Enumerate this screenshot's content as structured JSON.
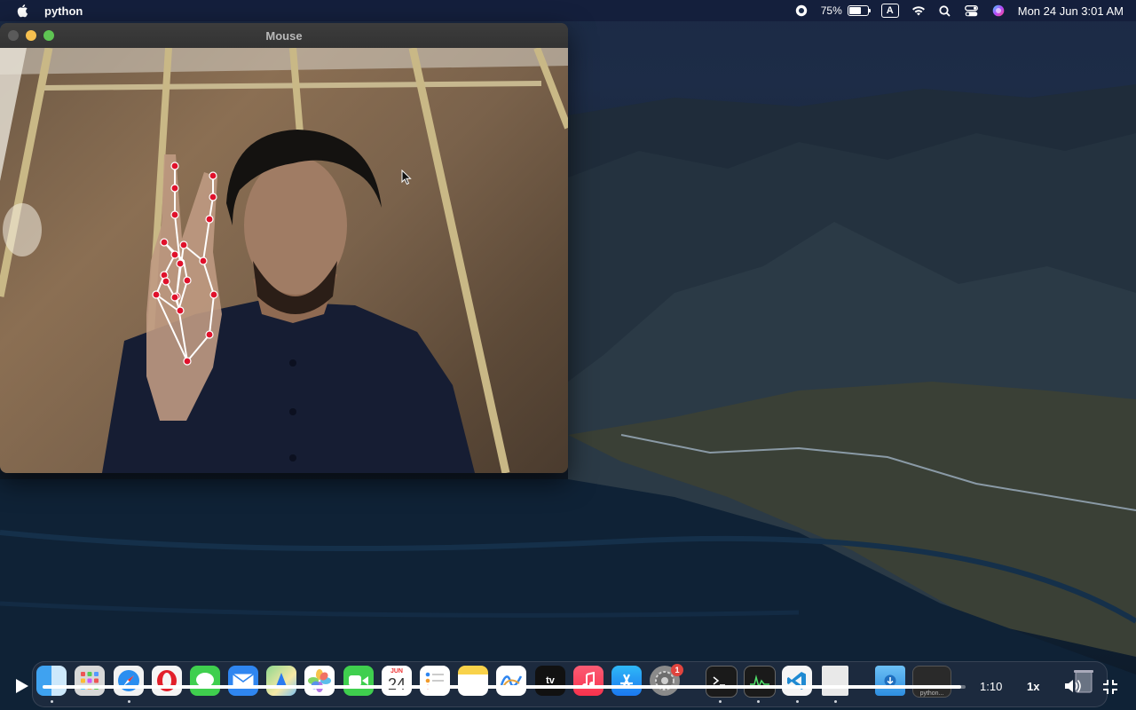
{
  "menubar": {
    "app_name": "python",
    "battery_percent": "75%",
    "battery_level": 0.75,
    "input_source": "A",
    "datetime": "Mon 24 Jun  3:01 AM"
  },
  "window": {
    "title": "Mouse"
  },
  "player": {
    "time": "1:10",
    "speed": "1x",
    "progress": 0.995
  },
  "dock": {
    "calendar_month": "JUN",
    "calendar_day": "24",
    "settings_badge": "1",
    "tv_label": "tv",
    "window_thumb_label": "python..."
  },
  "colors": {
    "traffic_close": "#5a5a5a",
    "traffic_min": "#f5bf4f",
    "traffic_max": "#5fc453",
    "landmark": "#e0112b"
  }
}
